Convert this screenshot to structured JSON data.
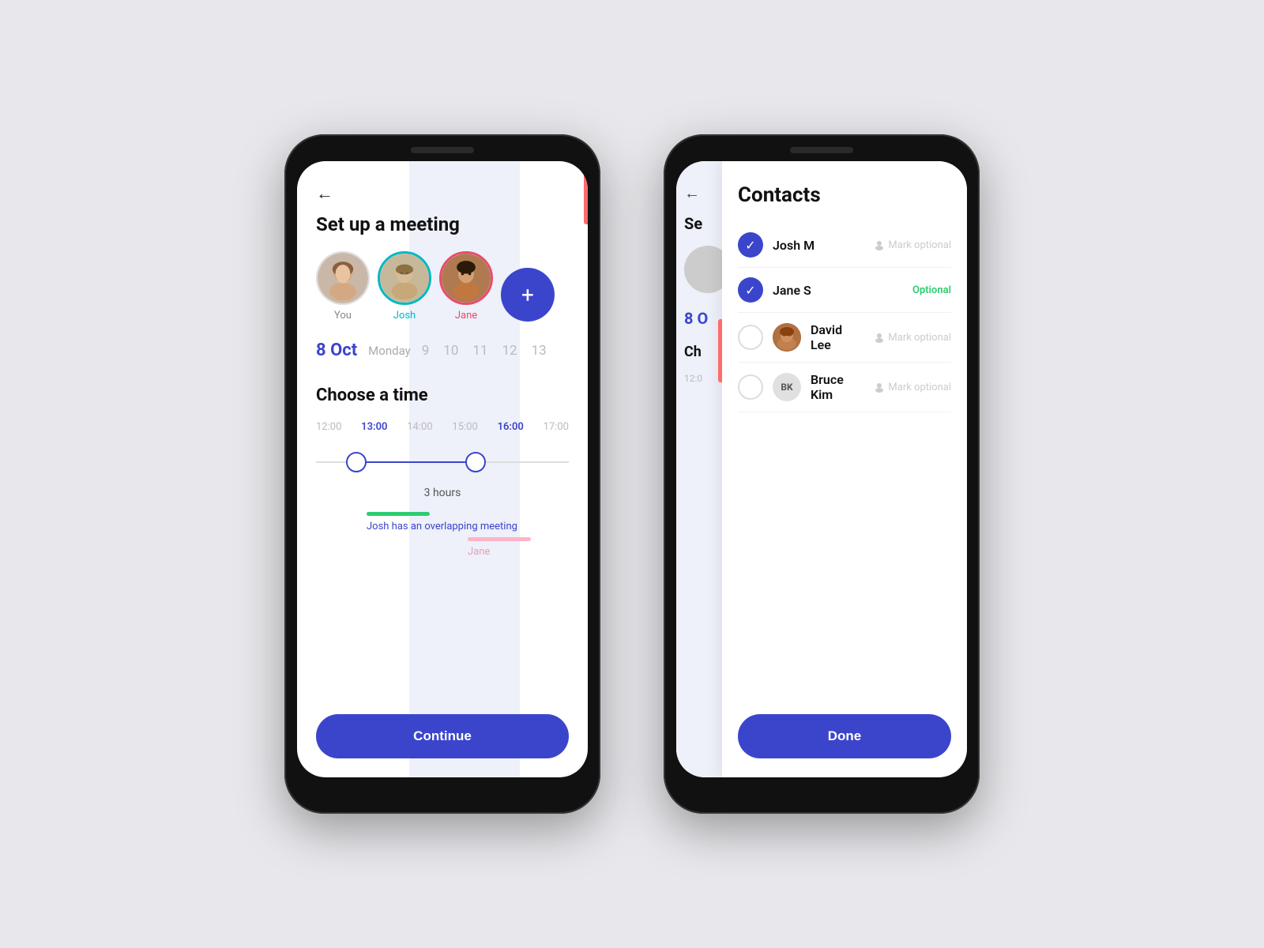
{
  "left_phone": {
    "back_arrow": "←",
    "title": "Set up a meeting",
    "avatars": [
      {
        "label": "You",
        "label_class": ""
      },
      {
        "label": "Josh",
        "label_class": "teal"
      },
      {
        "label": "Jane",
        "label_class": "red"
      }
    ],
    "add_button_icon": "+",
    "date": {
      "active": "8 Oct",
      "day": "Monday",
      "numbers": [
        "9",
        "10",
        "11",
        "12",
        "13"
      ]
    },
    "choose_time_title": "Choose a time",
    "time_labels": [
      "12:00",
      "13:00",
      "14:00",
      "15:00",
      "16:00",
      "17:00"
    ],
    "duration": "3 hours",
    "overlap_message": "Josh has an overlapping meeting",
    "jane_label": "Jane",
    "continue_button": "Continue"
  },
  "right_phone": {
    "back_arrow": "←",
    "contacts_title": "Contacts",
    "behind_title": "Se",
    "behind_date": "8 O",
    "behind_choose": "Ch",
    "behind_time": "12:0",
    "contacts": [
      {
        "name": "Josh M",
        "checked": true,
        "optional_label": "Mark optional",
        "optional_class": "mark-optional"
      },
      {
        "name": "Jane S",
        "checked": true,
        "optional_label": "Optional",
        "optional_class": "mark-optional-green"
      },
      {
        "name": "David Lee",
        "checked": false,
        "optional_label": "Mark optional",
        "optional_class": "mark-optional"
      },
      {
        "name": "Bruce Kim",
        "initials": "BK",
        "checked": false,
        "optional_label": "Mark optional",
        "optional_class": "mark-optional"
      }
    ],
    "done_button": "Done"
  }
}
